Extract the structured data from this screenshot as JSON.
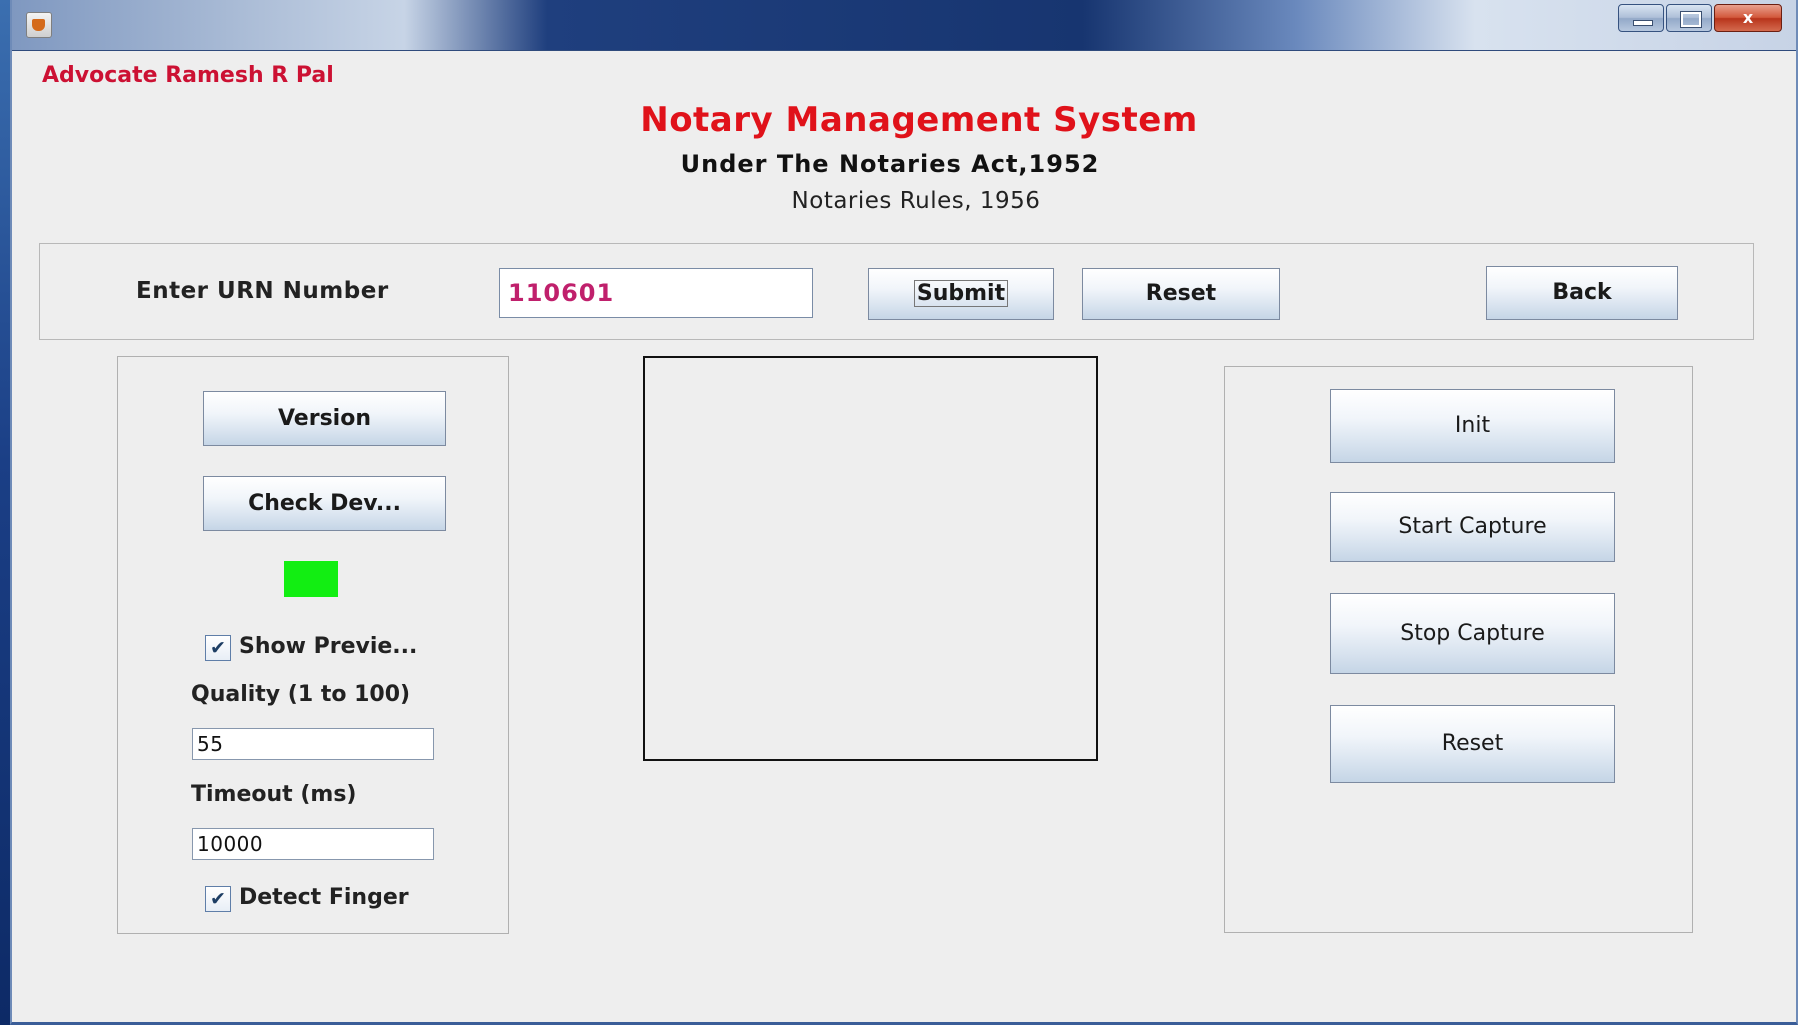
{
  "window": {
    "app_icon": "java-cup-icon",
    "controls": {
      "close": "x"
    }
  },
  "header": {
    "advocate": "Advocate Ramesh R Pal",
    "title": "Notary Management System",
    "subtitle": "Under The Notaries Act,1952",
    "rules": "Notaries Rules, 1956"
  },
  "urn": {
    "label": "Enter URN Number",
    "value": "110601",
    "submit": "Submit",
    "reset": "Reset",
    "back": "Back"
  },
  "left_panel": {
    "version": "Version",
    "check_device": "Check Dev...",
    "status_color": "#12ee12",
    "show_preview": "Show Previe...",
    "show_preview_checked": true,
    "quality_label": "Quality (1 to 100)",
    "quality_value": "55",
    "timeout_label": "Timeout (ms)",
    "timeout_value": "10000",
    "detect_finger": "Detect Finger",
    "detect_finger_checked": true
  },
  "right_panel": {
    "init": "Init",
    "start_capture": "Start Capture",
    "stop_capture": "Stop Capture",
    "reset": "Reset"
  }
}
